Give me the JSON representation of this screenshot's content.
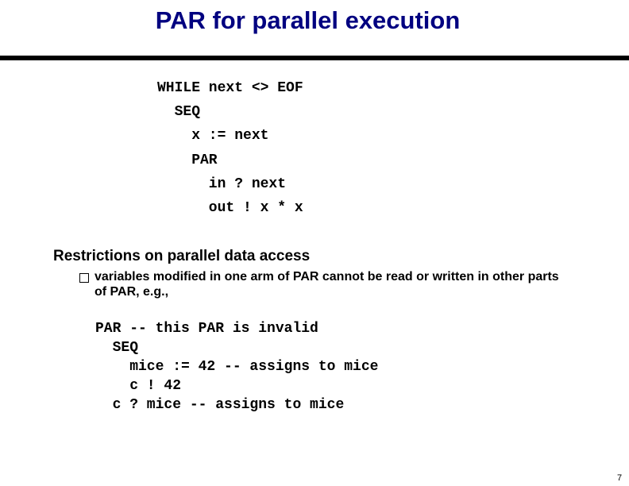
{
  "slide": {
    "title": "PAR for parallel execution",
    "code_example_1": [
      "WHILE next <> EOF",
      "  SEQ",
      "    x := next",
      "    PAR",
      "      in ? next",
      "      out ! x * x"
    ],
    "section_heading": "Restrictions on parallel data access",
    "bullets": [
      {
        "icon": "square-bullet-icon",
        "text": "variables modified in one arm of PAR cannot be read or written in other parts of PAR, e.g.,"
      }
    ],
    "code_example_2": [
      "PAR -- this PAR is invalid",
      "  SEQ",
      "    mice := 42 -- assigns to mice",
      "    c ! 42",
      "  c ? mice -- assigns to mice"
    ],
    "page_number": "7"
  },
  "colors": {
    "title": "#000080",
    "text": "#000000",
    "rule": "#000000",
    "background": "#ffffff"
  }
}
